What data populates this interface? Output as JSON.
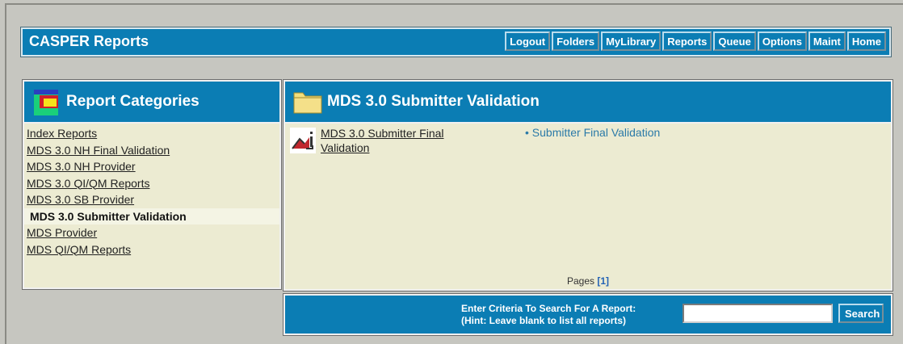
{
  "header": {
    "title": "CASPER Reports",
    "nav": [
      "Logout",
      "Folders",
      "MyLibrary",
      "Reports",
      "Queue",
      "Options",
      "Maint",
      "Home"
    ]
  },
  "sidebar": {
    "title": "Report Categories",
    "items": [
      {
        "label": "Index Reports"
      },
      {
        "label": "MDS 3.0 NH Final Validation"
      },
      {
        "label": "MDS 3.0 NH Provider"
      },
      {
        "label": "MDS 3.0 QI/QM Reports"
      },
      {
        "label": "MDS 3.0 SB Provider"
      },
      {
        "label": "MDS 3.0 Submitter Validation",
        "active": true
      },
      {
        "label": "MDS Provider"
      },
      {
        "label": "MDS QI/QM Reports"
      }
    ]
  },
  "main": {
    "title": "MDS 3.0 Submitter Validation",
    "report": {
      "link": "MDS 3.0 Submitter Final Validation",
      "bullet": "Submitter Final Validation"
    },
    "pages_label": "Pages",
    "pages_value": "[1]"
  },
  "search": {
    "line1": "Enter Criteria To Search For A Report:",
    "line2": "(Hint: Leave blank to list all reports)",
    "value": "",
    "button": "Search"
  },
  "colors": {
    "accent": "#0b7db4",
    "panel": "#ecebd2",
    "background": "#c6c6c0"
  }
}
